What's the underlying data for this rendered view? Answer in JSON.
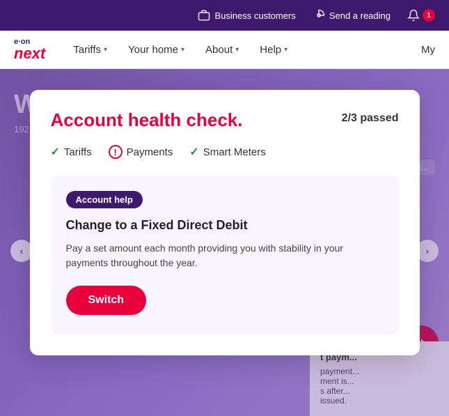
{
  "topbar": {
    "business_customers_label": "Business customers",
    "send_reading_label": "Send a reading",
    "notification_count": "1"
  },
  "nav": {
    "logo_eon": "e·on",
    "logo_next": "next",
    "items": [
      {
        "label": "Tariffs"
      },
      {
        "label": "Your home"
      },
      {
        "label": "About"
      },
      {
        "label": "Help"
      },
      {
        "label": "My"
      }
    ]
  },
  "bg": {
    "welcome_text": "W...",
    "address": "192 G...",
    "right_badge": "Ac...",
    "next_payment_title": "t paym...",
    "next_payment_body": "payment...\nment is...\ns after...\nissued."
  },
  "modal": {
    "title": "Account health check.",
    "passed_label": "2/3 passed",
    "checks": [
      {
        "label": "Tariffs",
        "status": "pass"
      },
      {
        "label": "Payments",
        "status": "warning"
      },
      {
        "label": "Smart Meters",
        "status": "pass"
      }
    ],
    "inner_card": {
      "badge_label": "Account help",
      "title": "Change to a Fixed Direct Debit",
      "description": "Pay a set amount each month providing you with stability in your payments throughout the year.",
      "switch_button_label": "Switch"
    }
  }
}
